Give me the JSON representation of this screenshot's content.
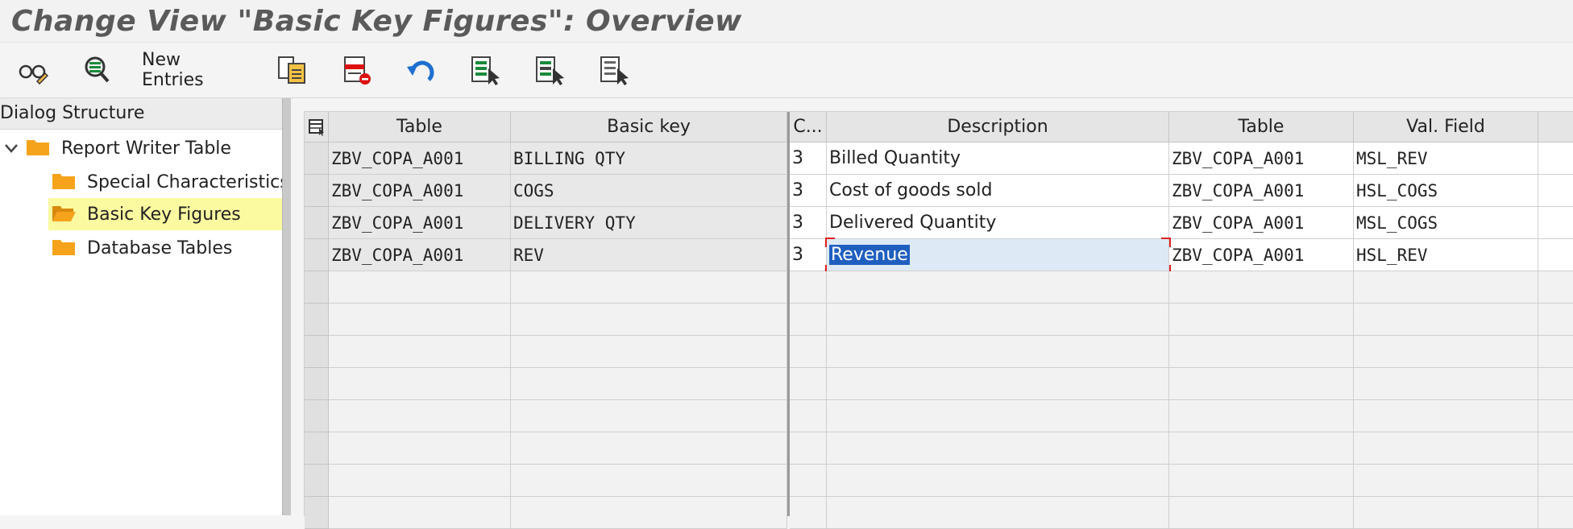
{
  "title": "Change View \"Basic Key Figures\": Overview",
  "toolbar": {
    "new_entries_label": "New Entries",
    "icons": [
      "display-change-icon",
      "select-display-icon",
      "copy-as-icon",
      "delete-icon",
      "undo-icon",
      "select-all-icon",
      "select-block-icon",
      "deselect-all-icon"
    ]
  },
  "dialog": {
    "header": "Dialog Structure",
    "tree": [
      {
        "label": "Report Writer Table",
        "expanded": true
      },
      {
        "label": "Special Characteristics"
      },
      {
        "label": "Basic Key Figures",
        "selected": true
      },
      {
        "label": "Database Tables"
      }
    ]
  },
  "grid": {
    "columns": [
      "Table",
      "Basic key",
      "C...",
      "Description",
      "Table",
      "Val. Field"
    ],
    "rows": [
      {
        "table": "ZBV_COPA_A001",
        "basic_key": "BILLING QTY",
        "c": "3",
        "description": "Billed Quantity",
        "table2": "ZBV_COPA_A001",
        "val_field": "MSL_REV"
      },
      {
        "table": "ZBV_COPA_A001",
        "basic_key": "COGS",
        "c": "3",
        "description": "Cost of goods sold",
        "table2": "ZBV_COPA_A001",
        "val_field": "HSL_COGS"
      },
      {
        "table": "ZBV_COPA_A001",
        "basic_key": "DELIVERY QTY",
        "c": "3",
        "description": "Delivered Quantity",
        "table2": "ZBV_COPA_A001",
        "val_field": "MSL_COGS"
      },
      {
        "table": "ZBV_COPA_A001",
        "basic_key": "REV",
        "c": "3",
        "description": "Revenue",
        "table2": "ZBV_COPA_A001",
        "val_field": "HSL_REV"
      }
    ],
    "focused_cell": "description",
    "colors": {
      "selection": "#1f5fbf",
      "highlight": "#fbfaa0",
      "folder": "#f5a31a"
    }
  }
}
